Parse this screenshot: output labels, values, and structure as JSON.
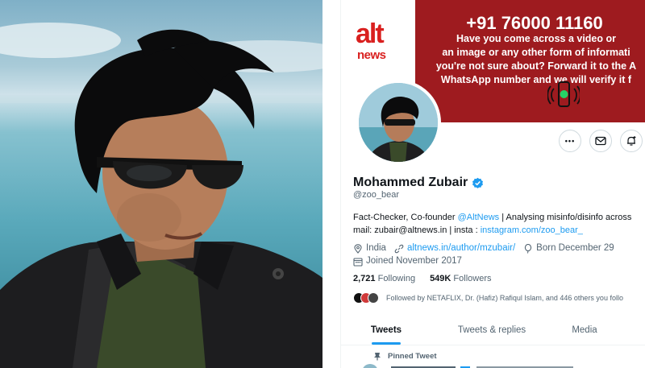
{
  "banner": {
    "logo_top": "alt",
    "logo_bottom": "news",
    "phone": "+91 76000 11160",
    "message_lines": [
      "Have you come across a video or",
      "an image or any other  form of informati",
      "you're not sure about? Forward it to the A",
      "WhatsApp number and we will verify it f"
    ],
    "icon": "whatsapp-phone-icon"
  },
  "actions": {
    "more": "•••",
    "message_icon": "envelope-icon",
    "notify_icon": "bell-plus-icon"
  },
  "profile": {
    "name": "Mohammed Zubair",
    "handle": "@zoo_bear",
    "bio_line1_prefix": "Fact-Checker, Co-founder ",
    "bio_line1_link": "@AltNews",
    "bio_line1_suffix": " | Analysing misinfo/disinfo across",
    "bio_line2_prefix": "mail: zubair@altnews.in | insta : ",
    "bio_line2_link": "instagram.com/zoo_bear_",
    "location": "India",
    "website": "altnews.in/author/mzubair/",
    "born": "Born December 29",
    "joined": "Joined November 2017"
  },
  "stats": {
    "following_count": "2,721",
    "following_label": "Following",
    "followers_count": "549K",
    "followers_label": "Followers"
  },
  "followed_by": "Followed by NETAFLIX, Dr. (Hafiz) Rafiqul Islam, and 446 others you follo",
  "tabs": [
    "Tweets",
    "Tweets & replies",
    "Media"
  ],
  "pinned_label": "Pinned Tweet",
  "colors": {
    "accent": "#1d9bf0",
    "banner_red": "#9e1b1f",
    "logo_red": "#d9201f",
    "text_secondary": "#536471"
  }
}
